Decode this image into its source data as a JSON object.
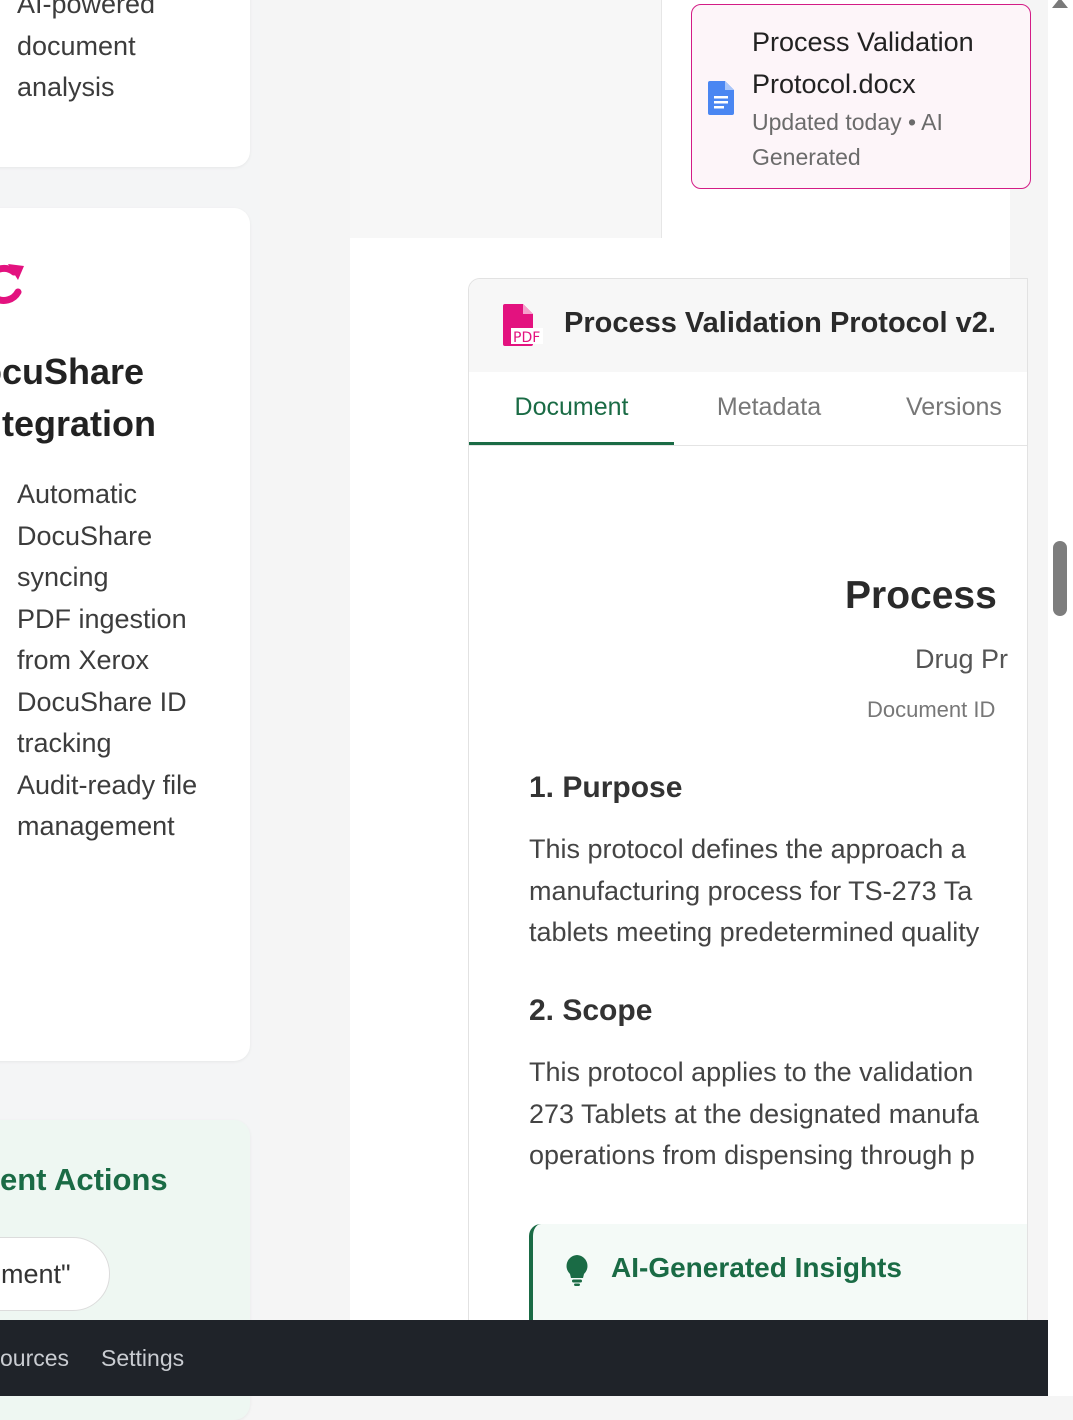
{
  "left_panel": {
    "card1": {
      "text": "AI-powered document analysis"
    },
    "integration": {
      "title_line1": "DocuShare",
      "title_line2": "Integration",
      "title_visible_line1": "ocuShare",
      "title_visible_line2": "ntegration",
      "features": [
        "Automatic DocuShare syncing",
        "PDF ingestion from Xerox",
        "DocuShare ID tracking",
        "Audit-ready file management"
      ]
    },
    "recent_actions": {
      "title_visible": "ent Actions",
      "chip_visible": "ment\""
    }
  },
  "file_card": {
    "name": "Process Validation Protocol.docx",
    "meta": "Updated today • AI Generated",
    "icon": "google-doc-icon",
    "border_color": "#d31c86"
  },
  "viewer": {
    "title_visible": "Process Validation Protocol v2.",
    "icon": "pdf-file-icon",
    "tabs": [
      {
        "label": "Document",
        "active": true
      },
      {
        "label": "Metadata",
        "active": false
      },
      {
        "label": "Versions",
        "active": false
      }
    ],
    "document": {
      "title_visible": "Process",
      "subtitle_visible": "Drug Pr",
      "doc_id_visible": "Document ID",
      "sections": [
        {
          "heading": "1. Purpose",
          "lines": [
            "This protocol defines the approach a",
            "manufacturing process for TS-273 Ta",
            "tablets meeting predetermined quality"
          ]
        },
        {
          "heading": "2. Scope",
          "lines": [
            "This protocol applies to the validation",
            "273 Tablets at the designated manufa",
            "operations from dispensing through p"
          ]
        }
      ],
      "insights_title": "AI-Generated Insights"
    }
  },
  "bottom_nav": {
    "items": [
      "ources",
      "Settings"
    ]
  },
  "colors": {
    "accent_green": "#1a6b45",
    "accent_pink": "#e3127f",
    "bottom_bar": "#1f2329"
  }
}
